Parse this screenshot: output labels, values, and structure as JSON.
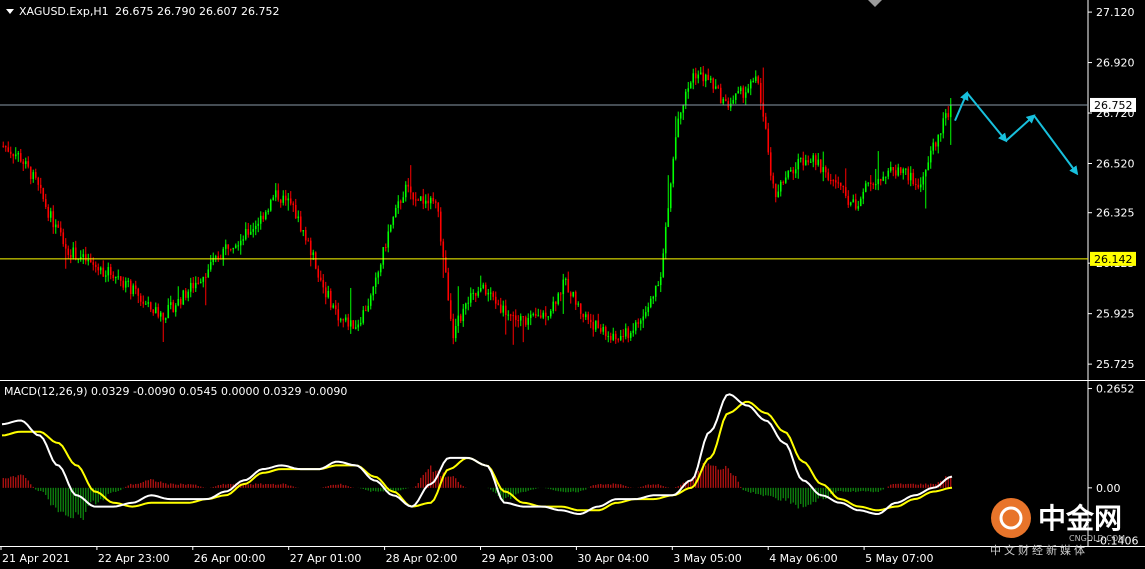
{
  "main": {
    "symbol": "XAGUSD.Exp,H1",
    "ohlc": "26.675 26.790 26.607 26.752",
    "price_ticks": [
      "27.120",
      "26.920",
      "26.720",
      "26.520",
      "26.325",
      "26.125",
      "25.925",
      "25.725"
    ],
    "current_price": "26.752",
    "level_price": "26.142"
  },
  "macd": {
    "label": "MACD(12,26,9) 0.0329 -0.0090 0.0545 0.0000 0.0329 -0.0090",
    "ticks": [
      "0.2652",
      "0.00",
      "-0.1406"
    ]
  },
  "time_ticks": [
    "21 Apr 2021",
    "22 Apr 23:00",
    "26 Apr 00:00",
    "27 Apr 01:00",
    "28 Apr 02:00",
    "29 Apr 03:00",
    "30 Apr 04:00",
    "3 May 05:00",
    "4 May 06:00",
    "5 May 07:00"
  ],
  "watermark": {
    "title": "中金网",
    "domain": "CNGOLD.COM",
    "subtitle": "中文财经新媒体"
  },
  "colors": {
    "background": "#000000",
    "bull": "#00ff00",
    "bear": "#ff0000",
    "level_line": "#ffff00",
    "current_line": "#8a9aa8",
    "macd_main": "#ffffff",
    "macd_signal": "#ffff00",
    "arrow": "#18c0dd"
  },
  "chart_data": [
    {
      "type": "candlestick",
      "title": "XAGUSD.Exp,H1",
      "ylim": [
        25.67,
        27.16
      ],
      "anchor_prices": [
        26.59,
        26.55,
        26.45,
        26.3,
        26.18,
        26.14,
        26.1,
        26.08,
        26.02,
        25.95,
        25.92,
        25.98,
        26.05,
        26.12,
        26.2,
        26.23,
        26.3,
        26.4,
        26.35,
        26.2,
        26.02,
        25.9,
        25.88,
        26.0,
        26.25,
        26.42,
        26.38,
        26.35,
        25.85,
        25.98,
        26.02,
        25.95,
        25.9,
        25.9,
        25.94,
        26.05,
        25.93,
        25.87,
        25.82,
        25.85,
        25.92,
        26.1,
        26.7,
        26.88,
        26.85,
        26.75,
        26.8,
        26.85,
        26.4,
        26.48,
        26.55,
        26.5,
        26.43,
        26.35,
        26.45,
        26.48,
        26.5,
        26.42,
        26.6,
        26.75
      ],
      "last_close": 26.752,
      "level_price": 26.142,
      "forecast_arrow": [
        {
          "point": "start",
          "price": 26.69
        },
        {
          "point": "peak",
          "price": 26.8
        },
        {
          "point": "trough",
          "price": 26.61
        },
        {
          "point": "peak",
          "price": 26.71
        },
        {
          "point": "end",
          "price": 26.48
        }
      ]
    },
    {
      "type": "histogram+line",
      "title": "MACD(12,26,9)",
      "ylim": [
        -0.15,
        0.28
      ],
      "main_line": [
        0.17,
        0.18,
        0.14,
        0.06,
        -0.02,
        -0.05,
        -0.05,
        -0.04,
        -0.02,
        -0.03,
        -0.03,
        -0.03,
        -0.01,
        0.02,
        0.05,
        0.06,
        0.05,
        0.05,
        0.07,
        0.06,
        0.02,
        -0.02,
        -0.05,
        0.01,
        0.08,
        0.08,
        0.06,
        -0.04,
        -0.05,
        -0.05,
        -0.06,
        -0.07,
        -0.05,
        -0.03,
        -0.03,
        -0.02,
        -0.02,
        0.02,
        0.15,
        0.25,
        0.22,
        0.18,
        0.12,
        0.02,
        -0.02,
        -0.04,
        -0.06,
        -0.07,
        -0.04,
        -0.02,
        0.0,
        0.03
      ],
      "signal_line": [
        0.14,
        0.15,
        0.15,
        0.12,
        0.06,
        -0.01,
        -0.04,
        -0.05,
        -0.04,
        -0.04,
        -0.04,
        -0.03,
        -0.02,
        0.01,
        0.04,
        0.05,
        0.05,
        0.05,
        0.06,
        0.06,
        0.03,
        -0.01,
        -0.05,
        -0.04,
        0.05,
        0.08,
        0.06,
        -0.01,
        -0.04,
        -0.05,
        -0.05,
        -0.06,
        -0.06,
        -0.04,
        -0.03,
        -0.03,
        -0.02,
        0.0,
        0.08,
        0.2,
        0.23,
        0.2,
        0.15,
        0.07,
        0.01,
        -0.03,
        -0.05,
        -0.06,
        -0.05,
        -0.03,
        -0.01,
        0.0
      ],
      "histogram": [
        0.03,
        0.03,
        -0.01,
        -0.06,
        -0.08,
        -0.04,
        -0.01,
        0.01,
        0.02,
        0.01,
        0.01,
        0.0,
        0.01,
        0.01,
        0.01,
        0.01,
        0.0,
        0.0,
        0.01,
        0.0,
        -0.01,
        -0.01,
        0.0,
        0.05,
        0.03,
        0.0,
        0.0,
        -0.03,
        -0.01,
        0.0,
        -0.01,
        -0.01,
        0.01,
        0.01,
        0.0,
        0.01,
        0.0,
        0.02,
        0.07,
        0.05,
        -0.01,
        -0.02,
        -0.03,
        -0.05,
        -0.03,
        -0.01,
        -0.01,
        -0.01,
        0.01,
        0.01,
        0.01,
        0.03
      ]
    }
  ]
}
